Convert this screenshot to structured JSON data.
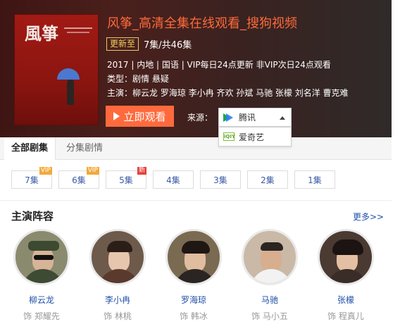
{
  "header": {
    "poster_title": "風箏",
    "title": "风筝_高清全集在线观看_搜狗视频",
    "update_badge": "更新至",
    "update_text": "7集/共46集",
    "meta_line1": "2017 | 内地 | 国语 | VIP每日24点更新 非VIP次日24点观看",
    "meta_line2": "类型：剧情 悬疑",
    "meta_line3": "主演：柳云龙 罗海琼 李小冉 齐欢 孙斌 马驰 张檬 刘名洋 曹克难",
    "play_label": "立即观看",
    "source_label": "来源：",
    "source_selected": "腾讯",
    "source_options": [
      "爱奇艺"
    ],
    "iqiyi_icon_text": "iQIY"
  },
  "tabs": [
    {
      "label": "全部剧集"
    },
    {
      "label": "分集剧情"
    }
  ],
  "episodes": [
    {
      "label": "7集",
      "badge": "VIP"
    },
    {
      "label": "6集",
      "badge": "VIP"
    },
    {
      "label": "5集",
      "badge": "新"
    },
    {
      "label": "4集",
      "badge": ""
    },
    {
      "label": "3集",
      "badge": ""
    },
    {
      "label": "2集",
      "badge": ""
    },
    {
      "label": "1集",
      "badge": ""
    }
  ],
  "cast_section": {
    "title": "主演阵容",
    "more": "更多>>"
  },
  "cast": [
    {
      "name": "柳云龙",
      "role": "饰 郑耀先"
    },
    {
      "name": "李小冉",
      "role": "饰 林桃"
    },
    {
      "name": "罗海琼",
      "role": "饰 韩冰"
    },
    {
      "name": "马驰",
      "role": "饰 马小五"
    },
    {
      "name": "张檬",
      "role": "饰 程真儿"
    }
  ],
  "colors": {
    "accent": "#ff6a3d",
    "link": "#1f4fa8",
    "vip_badge": "#f2a93b",
    "new_badge": "#e8403a"
  }
}
